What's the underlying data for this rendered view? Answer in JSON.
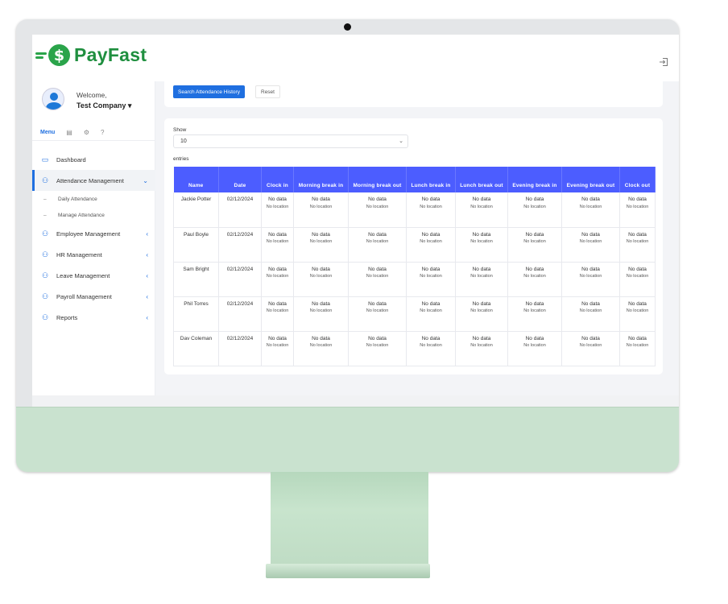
{
  "brand": {
    "name": "PayFast",
    "color": "#2aa44a"
  },
  "user": {
    "greeting": "Welcome,",
    "name": "Test Company ▾"
  },
  "menu_tab": "Menu",
  "nav": [
    {
      "label": "Dashboard",
      "icon": "laptop-icon"
    },
    {
      "label": "Attendance Management",
      "icon": "users-icon",
      "active": true,
      "chevron": "⌄"
    },
    {
      "label": "Employee Management",
      "icon": "users-icon",
      "chevron": "‹"
    },
    {
      "label": "HR Management",
      "icon": "users-icon",
      "chevron": "‹"
    },
    {
      "label": "Leave Management",
      "icon": "users-icon",
      "chevron": "‹"
    },
    {
      "label": "Payroll Management",
      "icon": "users-icon",
      "chevron": "‹"
    },
    {
      "label": "Reports",
      "icon": "users-icon",
      "chevron": "‹"
    }
  ],
  "subnav": [
    "Daily Attendance",
    "Manage Attendance"
  ],
  "actions": {
    "search": "Search Attendance History",
    "reset": "Reset"
  },
  "length": {
    "show": "Show",
    "value": "10",
    "entries": "entries"
  },
  "table": {
    "columns": [
      "Name",
      "Date",
      "Clock in",
      "Morning break in",
      "Morning break out",
      "Lunch break in",
      "Lunch break out",
      "Evening break in",
      "Evening break out",
      "Clock out"
    ],
    "rows": [
      {
        "name": "Jackie Potter",
        "date": "02/12/2024"
      },
      {
        "name": "Paul Boyle",
        "date": "02/12/2024"
      },
      {
        "name": "Sam Bright",
        "date": "02/12/2024"
      },
      {
        "name": "Phil Torres",
        "date": "02/12/2024"
      },
      {
        "name": "Dav Coleman",
        "date": "02/12/2024"
      }
    ],
    "cell_value": "No data",
    "cell_location": "No location"
  },
  "colors": {
    "accent": "#1f6fe0",
    "table_header": "#4c5dff",
    "stand": "#c9e2cf"
  }
}
